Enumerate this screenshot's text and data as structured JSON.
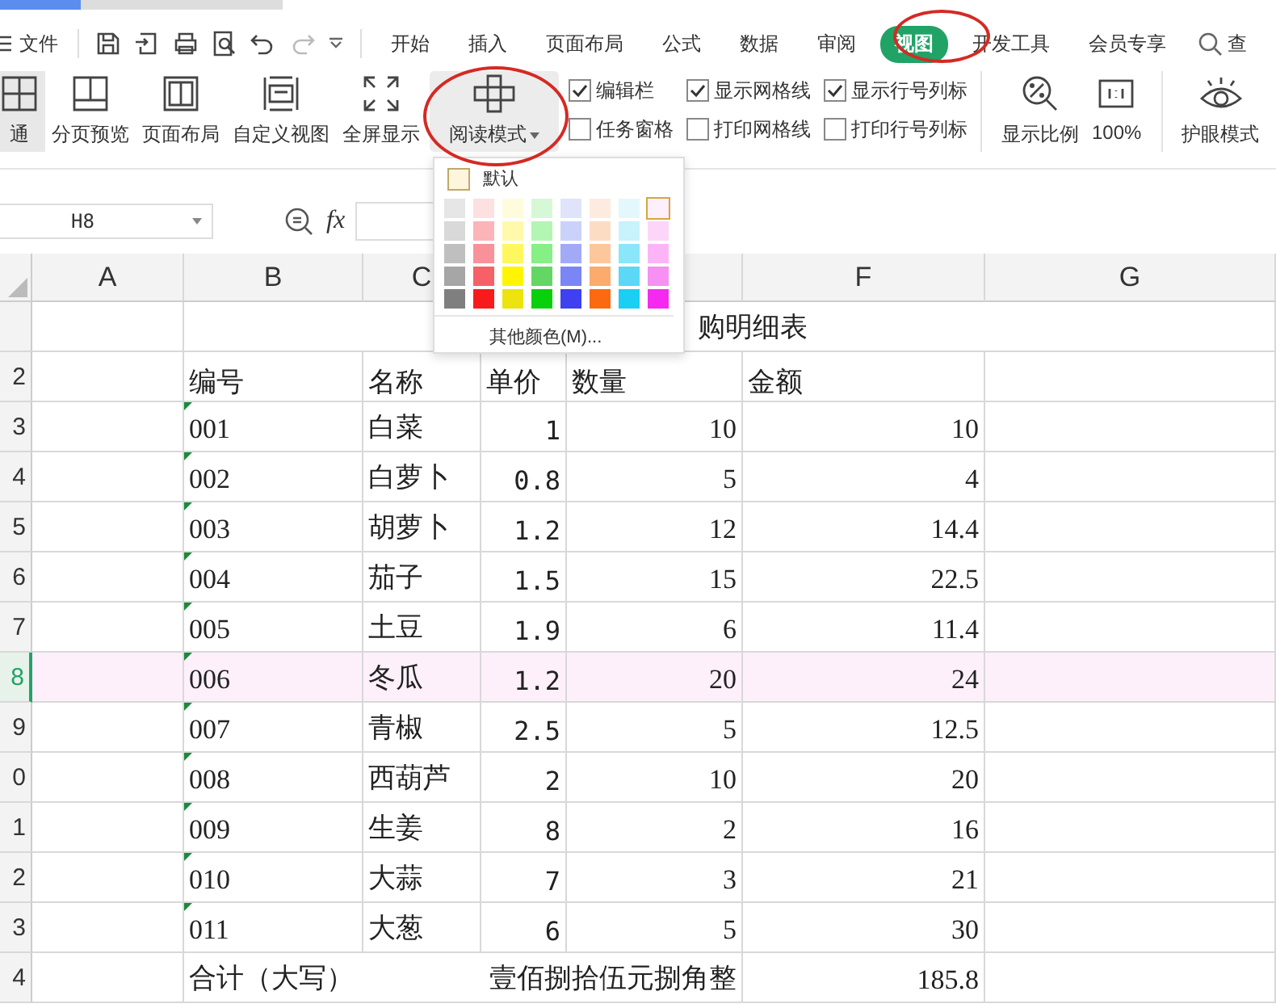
{
  "menu": {
    "file": "文件",
    "tabs": [
      {
        "label": "开始",
        "selected": false
      },
      {
        "label": "插入",
        "selected": false
      },
      {
        "label": "页面布局",
        "selected": false
      },
      {
        "label": "公式",
        "selected": false
      },
      {
        "label": "数据",
        "selected": false
      },
      {
        "label": "审阅",
        "selected": false
      },
      {
        "label": "视图",
        "selected": true
      },
      {
        "label": "开发工具",
        "selected": false
      },
      {
        "label": "会员专享",
        "selected": false
      }
    ],
    "search": "查"
  },
  "ribbon": {
    "views": [
      {
        "kind": "normal",
        "label": "通"
      },
      {
        "kind": "page-break",
        "label": "分页预览"
      },
      {
        "kind": "page-layout",
        "label": "页面布局"
      },
      {
        "kind": "custom",
        "label": "自定义视图"
      },
      {
        "kind": "fullscreen",
        "label": "全屏显示"
      }
    ],
    "reading_mode": "阅读模式",
    "checkboxes": [
      {
        "label": "编辑栏",
        "checked": true
      },
      {
        "label": "任务窗格",
        "checked": false
      },
      {
        "label": "显示网格线",
        "checked": true
      },
      {
        "label": "打印网格线",
        "checked": false
      },
      {
        "label": "显示行号列标",
        "checked": true
      },
      {
        "label": "打印行号列标",
        "checked": false
      }
    ],
    "zoom": "显示比例",
    "zoom_100": "100%",
    "eye_mode": "护眼模式"
  },
  "color_menu": {
    "default": "默认",
    "columns": [
      [
        {
          "color": "#e6e6e6",
          "selected": false
        },
        {
          "color": "#d9d9d9",
          "selected": false
        },
        {
          "color": "#bfbfbf",
          "selected": false
        },
        {
          "color": "#a6a6a6",
          "selected": false
        },
        {
          "color": "#7f7f7f",
          "selected": false
        }
      ],
      [
        {
          "color": "#fde0e0",
          "selected": false
        },
        {
          "color": "#fbb4b8",
          "selected": false
        },
        {
          "color": "#f8919a",
          "selected": false
        },
        {
          "color": "#f66168",
          "selected": false
        },
        {
          "color": "#f71b1b",
          "selected": false
        }
      ],
      [
        {
          "color": "#fffbdd",
          "selected": false
        },
        {
          "color": "#fff9ab",
          "selected": false
        },
        {
          "color": "#fff75e",
          "selected": false
        },
        {
          "color": "#fff500",
          "selected": false
        },
        {
          "color": "#ece30f",
          "selected": false
        }
      ],
      [
        {
          "color": "#d6f8d6",
          "selected": false
        },
        {
          "color": "#b3f5b3",
          "selected": false
        },
        {
          "color": "#86ef86",
          "selected": false
        },
        {
          "color": "#63d663",
          "selected": false
        },
        {
          "color": "#09d00c",
          "selected": false
        }
      ],
      [
        {
          "color": "#e0e4fa",
          "selected": false
        },
        {
          "color": "#cbd2fa",
          "selected": false
        },
        {
          "color": "#a2aaf8",
          "selected": false
        },
        {
          "color": "#7a86f5",
          "selected": false
        },
        {
          "color": "#3f40f0",
          "selected": false
        }
      ],
      [
        {
          "color": "#fdebdf",
          "selected": false
        },
        {
          "color": "#fddcc4",
          "selected": false
        },
        {
          "color": "#fcc79c",
          "selected": false
        },
        {
          "color": "#fbab6c",
          "selected": false
        },
        {
          "color": "#fb6a10",
          "selected": false
        }
      ],
      [
        {
          "color": "#e4f7fd",
          "selected": false
        },
        {
          "color": "#c8f2fc",
          "selected": false
        },
        {
          "color": "#8ae6f8",
          "selected": false
        },
        {
          "color": "#5ad8f6",
          "selected": false
        },
        {
          "color": "#1acff3",
          "selected": false
        }
      ],
      [
        {
          "color": "#fdf0fb",
          "selected": true
        },
        {
          "color": "#fcd6f8",
          "selected": false
        },
        {
          "color": "#fbb5f7",
          "selected": false
        },
        {
          "color": "#f690f3",
          "selected": false
        },
        {
          "color": "#f529ef",
          "selected": false
        }
      ]
    ],
    "more": "其他颜色(M)..."
  },
  "formula_bar": {
    "name_box": "H8",
    "fx": "fx"
  },
  "sheet": {
    "column_headers": [
      {
        "label": "A"
      },
      {
        "label": "B"
      },
      {
        "label": "C"
      },
      {
        "label": "F"
      },
      {
        "label": "G"
      }
    ],
    "rows": [
      {
        "kind": "title",
        "selected": false,
        "title": "购明细表"
      },
      {
        "kind": "header",
        "number": "2",
        "selected": false,
        "cells": [
          "编号",
          "名称",
          "单价",
          "数量",
          "金额"
        ]
      },
      {
        "kind": "item",
        "number": "3",
        "selected": false,
        "cells": [
          "001",
          "白菜",
          "1",
          "10",
          "10"
        ]
      },
      {
        "kind": "item",
        "number": "4",
        "selected": false,
        "cells": [
          "002",
          "白萝卜",
          "0.8",
          "5",
          "4"
        ]
      },
      {
        "kind": "item",
        "number": "5",
        "selected": false,
        "cells": [
          "003",
          "胡萝卜",
          "1.2",
          "12",
          "14.4"
        ]
      },
      {
        "kind": "item",
        "number": "6",
        "selected": false,
        "cells": [
          "004",
          "茄子",
          "1.5",
          "15",
          "22.5"
        ]
      },
      {
        "kind": "item",
        "number": "7",
        "selected": false,
        "cells": [
          "005",
          "土豆",
          "1.9",
          "6",
          "11.4"
        ]
      },
      {
        "kind": "item",
        "number": "8",
        "selected": true,
        "cells": [
          "006",
          "冬瓜",
          "1.2",
          "20",
          "24"
        ]
      },
      {
        "kind": "item",
        "number": "9",
        "selected": false,
        "cells": [
          "007",
          "青椒",
          "2.5",
          "5",
          "12.5"
        ]
      },
      {
        "kind": "item",
        "number": "0",
        "selected": false,
        "cells": [
          "008",
          "西葫芦",
          "2",
          "10",
          "20"
        ]
      },
      {
        "kind": "item",
        "number": "1",
        "selected": false,
        "cells": [
          "009",
          "生姜",
          "8",
          "2",
          "16"
        ]
      },
      {
        "kind": "item",
        "number": "2",
        "selected": false,
        "cells": [
          "010",
          "大蒜",
          "7",
          "3",
          "21"
        ]
      },
      {
        "kind": "item",
        "number": "3",
        "selected": false,
        "cells": [
          "011",
          "大葱",
          "6",
          "5",
          "30"
        ]
      },
      {
        "kind": "total",
        "number": "4",
        "selected": false,
        "label": "合计（大写）",
        "words": "壹佰捌拾伍元捌角整",
        "amount": "185.8"
      }
    ]
  }
}
